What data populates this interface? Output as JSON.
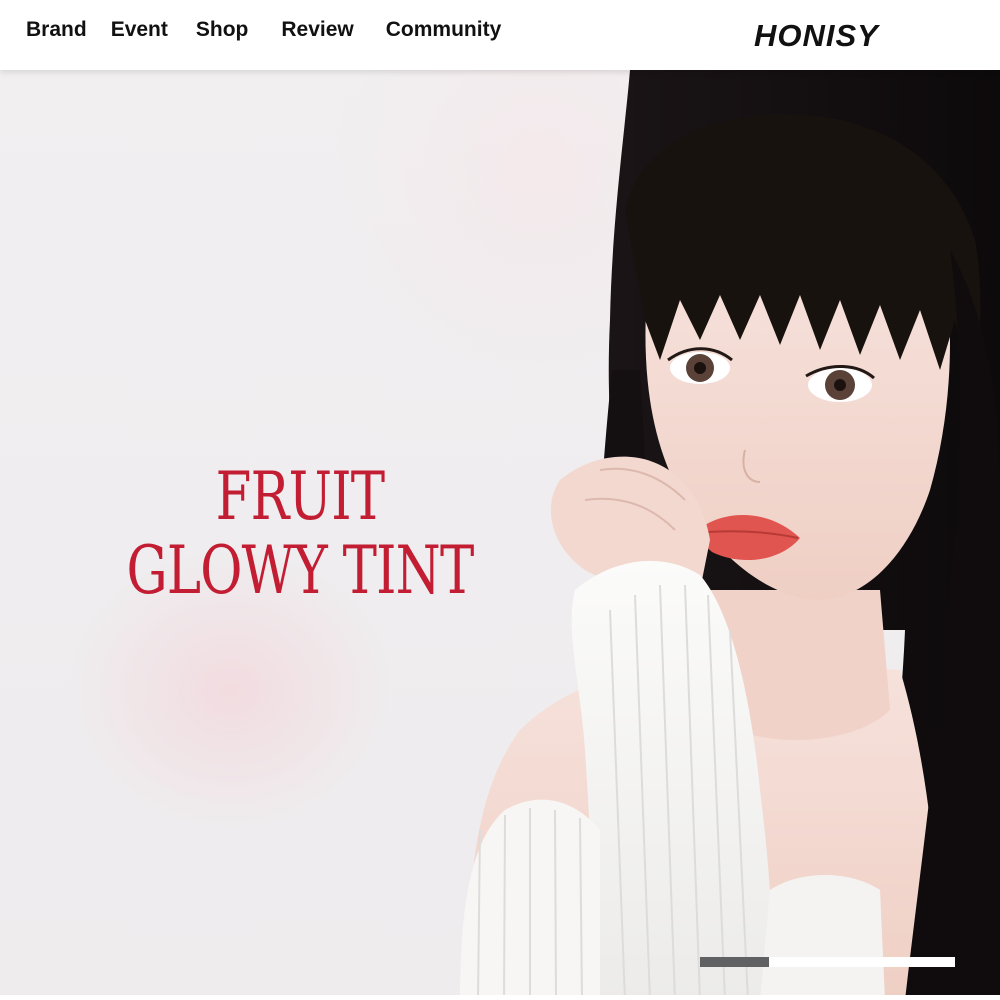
{
  "header": {
    "nav": [
      "Brand",
      "Event",
      "Shop",
      "Review",
      "Community"
    ],
    "logo": "HONISY"
  },
  "hero": {
    "headline": [
      "FRUIT",
      "GLOWY TINT"
    ],
    "headline_color": "#c21d32"
  },
  "slider": {
    "progress": 0.27,
    "track_color": "#ffffff",
    "fill_color": "#5f6162"
  }
}
